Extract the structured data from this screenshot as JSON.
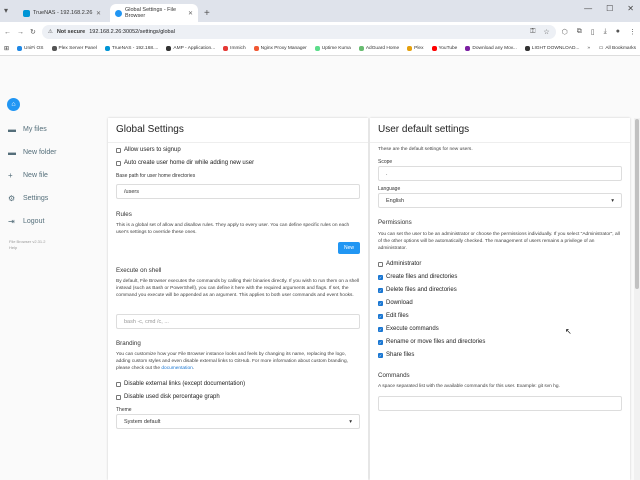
{
  "browser": {
    "tabs": [
      {
        "title": "TrueNAS - 192.168.2.26",
        "active": false,
        "color": "#0095d5"
      },
      {
        "title": "Global Settings - File Browser",
        "active": true,
        "color": "#2196f3"
      }
    ],
    "url_security": "Not secure",
    "url": "192.168.2.26:30052/settings/global",
    "bookmarks": [
      {
        "label": "UniFi OS",
        "color": "#1e88e5"
      },
      {
        "label": "Plex Server Panel",
        "color": "#555555"
      },
      {
        "label": "TrueNAS - 192.168....",
        "color": "#0095d5"
      },
      {
        "label": "AMP - Application...",
        "color": "#333333"
      },
      {
        "label": "Immich",
        "color": "#e53935"
      },
      {
        "label": "Nginx Proxy Manager",
        "color": "#f15833"
      },
      {
        "label": "Uptime Kuma",
        "color": "#5cdd8b"
      },
      {
        "label": "AdGuard Home",
        "color": "#68bc71"
      },
      {
        "label": "Plex",
        "color": "#e5a00d"
      },
      {
        "label": "YouTube",
        "color": "#ff0000"
      },
      {
        "label": "Download any Mov...",
        "color": "#7b1fa2"
      },
      {
        "label": "LIGHT DOWNLOAD...",
        "color": "#333333"
      }
    ],
    "all_bookmarks": "All Bookmarks"
  },
  "sidebar": {
    "items": [
      {
        "label": "My files",
        "icon": "folder-icon"
      },
      {
        "label": "New folder",
        "icon": "new-folder-icon"
      },
      {
        "label": "New file",
        "icon": "new-file-icon"
      },
      {
        "label": "Settings",
        "icon": "gear-icon"
      },
      {
        "label": "Logout",
        "icon": "logout-icon"
      }
    ],
    "version": "File Browser v2.31.2",
    "help": "Help"
  },
  "global": {
    "title": "Global Settings",
    "allow_signup": "Allow users to signup",
    "create_home": "Auto create user home dir while adding new user",
    "base_path_label": "Base path for user home directories",
    "base_path_value": "/users",
    "rules_title": "Rules",
    "rules_desc": "This is a global set of allow and disallow rules. They apply to every user. You can define specific rules on each user's settings to override these ones.",
    "new_button": "New",
    "shell_title": "Execute on shell",
    "shell_desc": "By default, File Browser executes the commands by calling their binaries directly. If you wish to run them on a shell instead (such as Bash or PowerShell), you can define it here with the required arguments and flags. If set, the command you execute will be appended as an argument. This applies to both user commands and event hooks.",
    "shell_placeholder": "bash -c, cmd /c, ...",
    "branding_title": "Branding",
    "branding_desc": "You can customize how your File Browser instance looks and feels by changing its name, replacing the logo, adding custom styles and even disable external links to GitHub. For more information about custom branding, please check out the",
    "branding_link": "documentation",
    "disable_links": "Disable external links (except documentation)",
    "disable_disk": "Disable used disk percentage graph",
    "theme_label": "Theme",
    "theme_value": "System default"
  },
  "user_defaults": {
    "title": "User default settings",
    "desc": "These are the default settings for new users.",
    "scope_label": "Scope",
    "scope_value": ".",
    "language_label": "Language",
    "language_value": "English",
    "permissions_title": "Permissions",
    "permissions_desc": "You can set the user to be an administrator or choose the permissions individually. If you select \"Administrator\", all of the other options will be automatically checked. The management of users remains a privilege of an administrator.",
    "permissions": [
      {
        "label": "Administrator",
        "checked": false
      },
      {
        "label": "Create files and directories",
        "checked": true
      },
      {
        "label": "Delete files and directories",
        "checked": true
      },
      {
        "label": "Download",
        "checked": true
      },
      {
        "label": "Edit files",
        "checked": true
      },
      {
        "label": "Execute commands",
        "checked": true
      },
      {
        "label": "Rename or move files and directories",
        "checked": true
      },
      {
        "label": "Share files",
        "checked": true
      }
    ],
    "commands_title": "Commands",
    "commands_desc": "A space separated list with the available commands for this user. Example: git svn hg."
  }
}
